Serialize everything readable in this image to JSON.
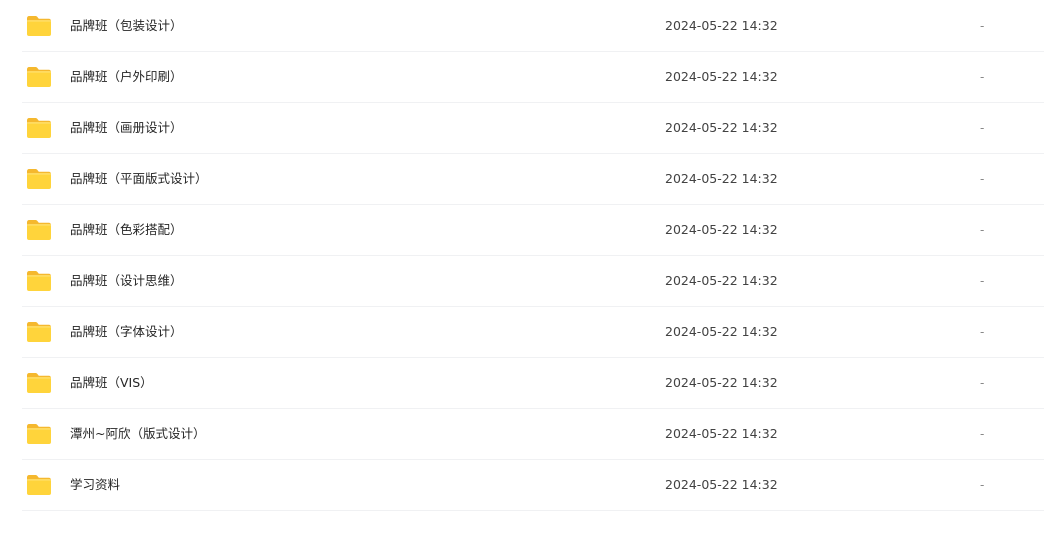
{
  "file_list": {
    "items": [
      {
        "name": "品牌班（包装设计）",
        "modified": "2024-05-22 14:32",
        "size": "-",
        "icon": "folder-icon"
      },
      {
        "name": "品牌班（户外印刷）",
        "modified": "2024-05-22 14:32",
        "size": "-",
        "icon": "folder-icon"
      },
      {
        "name": "品牌班（画册设计）",
        "modified": "2024-05-22 14:32",
        "size": "-",
        "icon": "folder-icon"
      },
      {
        "name": "品牌班（平面版式设计）",
        "modified": "2024-05-22 14:32",
        "size": "-",
        "icon": "folder-icon"
      },
      {
        "name": "品牌班（色彩搭配）",
        "modified": "2024-05-22 14:32",
        "size": "-",
        "icon": "folder-icon"
      },
      {
        "name": "品牌班（设计思维）",
        "modified": "2024-05-22 14:32",
        "size": "-",
        "icon": "folder-icon"
      },
      {
        "name": "品牌班（字体设计）",
        "modified": "2024-05-22 14:32",
        "size": "-",
        "icon": "folder-icon"
      },
      {
        "name": "品牌班（VIS）",
        "modified": "2024-05-22 14:32",
        "size": "-",
        "icon": "folder-icon"
      },
      {
        "name": "潭州~阿欣（版式设计）",
        "modified": "2024-05-22 14:32",
        "size": "-",
        "icon": "folder-icon"
      },
      {
        "name": "学习资料",
        "modified": "2024-05-22 14:32",
        "size": "-",
        "icon": "folder-icon"
      }
    ]
  },
  "colors": {
    "folder_body": "#FFD43B",
    "folder_tab": "#F5B82E",
    "row_divider": "#F0F1F3"
  }
}
